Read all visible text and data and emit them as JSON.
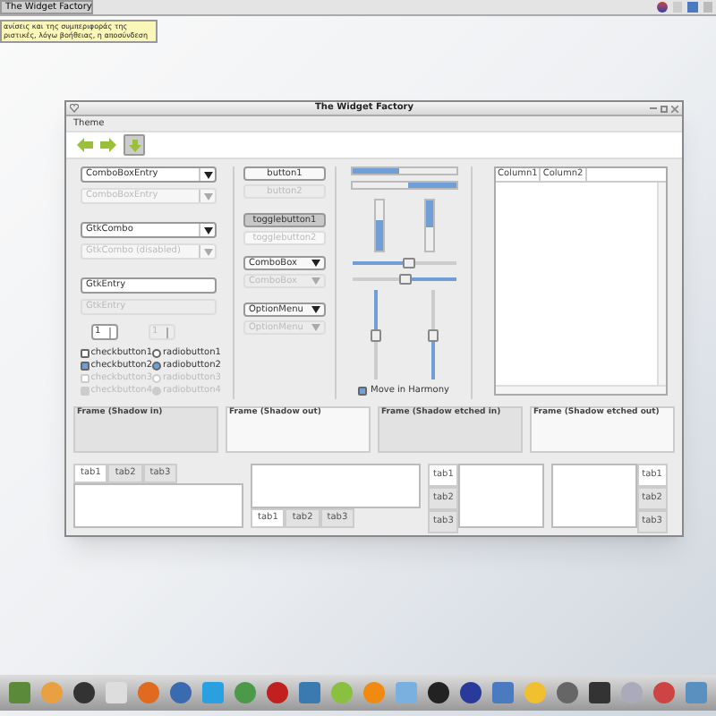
{
  "taskbar": {
    "window_button": "The Widget Factory"
  },
  "tooltip": {
    "lines": [
      "ανίσεις και της συμπεριφοράς της",
      "ριστικές, λόγω βοήθειας, η αποσύνδεση"
    ]
  },
  "window": {
    "title": "The Widget Factory",
    "menu": [
      "Theme"
    ]
  },
  "left": {
    "combos": [
      {
        "value": "ComboBoxEntry",
        "disabled": false
      },
      {
        "value": "ComboBoxEntry",
        "disabled": true
      },
      {
        "value": "GtkCombo",
        "disabled": false
      },
      {
        "value": "GtkCombo (disabled)",
        "disabled": true
      }
    ],
    "entries": [
      {
        "value": "GtkEntry",
        "disabled": false
      },
      {
        "value": "GtkEntry",
        "disabled": true
      }
    ],
    "spins": [
      {
        "value": "1",
        "disabled": false
      },
      {
        "value": "1",
        "disabled": true
      }
    ],
    "checks": [
      {
        "label": "checkbutton1",
        "checked": false,
        "disabled": false
      },
      {
        "label": "checkbutton2",
        "checked": true,
        "disabled": false
      },
      {
        "label": "checkbutton3",
        "checked": false,
        "disabled": true
      },
      {
        "label": "checkbutton4",
        "checked": true,
        "disabled": true
      }
    ],
    "radios": [
      {
        "label": "radiobutton1",
        "selected": false,
        "disabled": false
      },
      {
        "label": "radiobutton2",
        "selected": true,
        "disabled": false
      },
      {
        "label": "radiobutton3",
        "selected": false,
        "disabled": true
      },
      {
        "label": "radiobutton4",
        "selected": true,
        "disabled": true
      }
    ]
  },
  "middle": {
    "buttons": [
      {
        "label": "button1",
        "disabled": false
      },
      {
        "label": "button2",
        "disabled": true
      }
    ],
    "toggles": [
      {
        "label": "togglebutton1",
        "pressed": true,
        "disabled": false
      },
      {
        "label": "togglebutton2",
        "pressed": false,
        "disabled": true
      }
    ],
    "combos": [
      {
        "label": "ComboBox",
        "disabled": false
      },
      {
        "label": "ComboBox",
        "disabled": true
      },
      {
        "label": "OptionMenu",
        "disabled": false
      },
      {
        "label": "OptionMenu",
        "disabled": true
      }
    ]
  },
  "ranges": {
    "hbars": [
      {
        "level": 0.45,
        "inverted": false
      },
      {
        "level": 0.45,
        "inverted": true
      }
    ],
    "vbars": [
      {
        "level": 0.6,
        "inverted": false
      },
      {
        "level": 0.55,
        "inverted": true
      }
    ],
    "hsliders": [
      {
        "level": 0.55,
        "inverted": false
      },
      {
        "level": 0.5,
        "inverted": true
      }
    ],
    "vsliders": [
      {
        "level": 0.5,
        "inverted": false
      },
      {
        "level": 0.5,
        "inverted": true
      }
    ],
    "harmony": {
      "label": "Move in Harmony",
      "checked": true
    }
  },
  "tree": {
    "columns": [
      "Column1",
      "Column2"
    ]
  },
  "frames": [
    {
      "label": "Frame (Shadow in)",
      "kind": "in"
    },
    {
      "label": "Frame (Shadow out)",
      "kind": "out"
    },
    {
      "label": "Frame (Shadow etched in)",
      "kind": "in"
    },
    {
      "label": "Frame (Shadow etched out)",
      "kind": "out"
    }
  ],
  "notebooks": [
    {
      "kind": "top",
      "tabs": [
        {
          "label": "tab1",
          "selected": true
        },
        {
          "label": "tab2",
          "selected": false
        },
        {
          "label": "tab3",
          "selected": false
        }
      ]
    },
    {
      "kind": "bottom",
      "tabs": [
        {
          "label": "tab1",
          "selected": true
        },
        {
          "label": "tab2",
          "selected": false
        },
        {
          "label": "tab3",
          "selected": false
        }
      ]
    },
    {
      "kind": "left",
      "tabs": [
        {
          "label": "tab1",
          "selected": true
        },
        {
          "label": "tab2",
          "selected": false
        },
        {
          "label": "tab3",
          "selected": false
        }
      ]
    },
    {
      "kind": "right",
      "tabs": [
        {
          "label": "tab1",
          "selected": true
        },
        {
          "label": "tab2",
          "selected": false
        },
        {
          "label": "tab3",
          "selected": false
        }
      ]
    }
  ]
}
